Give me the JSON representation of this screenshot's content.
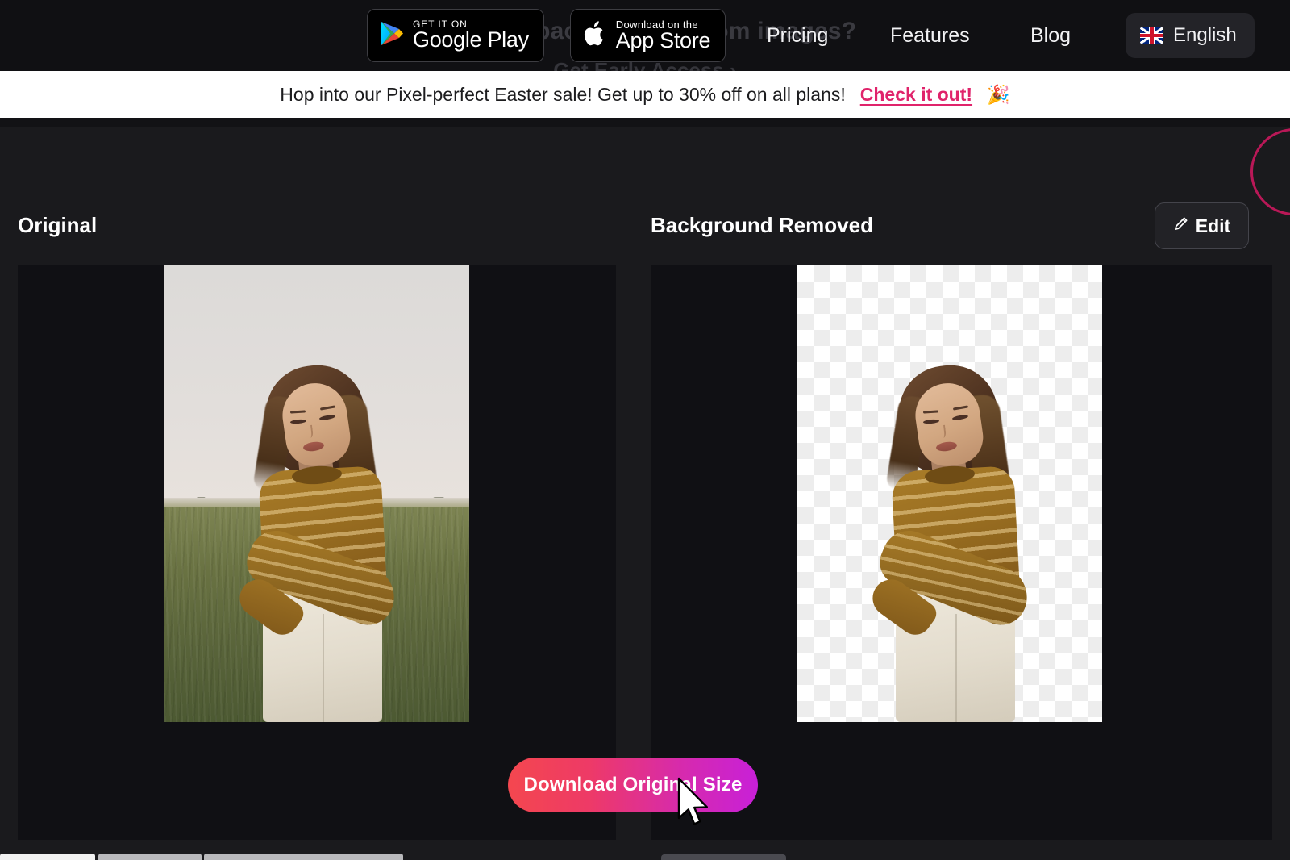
{
  "nav": {
    "google_play_badge": {
      "small": "GET IT ON",
      "big": "Google Play",
      "icon": "google-play-icon"
    },
    "app_store_badge": {
      "small": "Download on the",
      "big": "App Store",
      "icon": "apple-icon"
    },
    "links": [
      {
        "label": "Pricing"
      },
      {
        "label": "Features"
      },
      {
        "label": "Blog"
      }
    ],
    "language": {
      "label": "English",
      "flag": "uk-flag-icon"
    },
    "ghost_headline": "Remove backgrounds from images?",
    "ghost_subline": "Get Early Access  ›"
  },
  "promo": {
    "message": "Hop into our Pixel-perfect Easter sale! Get up to 30% off on all plans!",
    "cta": "Check it out!",
    "emoji": "🎉"
  },
  "result": {
    "original_title": "Original",
    "removed_title": "Background Removed",
    "edit_label": "Edit",
    "edit_icon": "pencil-icon",
    "download_label": "Download Original Size"
  },
  "colors": {
    "page_background": "#1a1a1d",
    "panel_background": "#101014",
    "promo_background": "#ffffff",
    "promo_cta": "#e0236b",
    "download_gradient_start": "#f4474f",
    "download_gradient_end": "#c820d8",
    "accent_circle": "#c2185b"
  }
}
